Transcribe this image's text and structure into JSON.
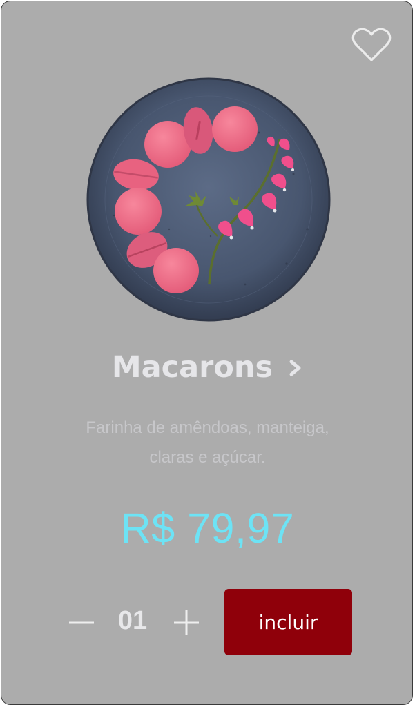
{
  "product": {
    "name": "Macarons",
    "description_line1": "Farinha de amêndoas, manteiga,",
    "description_line2": "claras e açúcar.",
    "price": "R$ 79,97",
    "image": "macarons-plate-image"
  },
  "quantity": {
    "value": "01",
    "decrement_icon": "minus-icon",
    "increment_icon": "plus-icon"
  },
  "actions": {
    "add_label": "incluir",
    "favorite_icon": "heart-outline-icon",
    "details_icon": "chevron-right-icon"
  },
  "colors": {
    "card_background": "#acacac",
    "price": "#6de3f5",
    "button": "#8f000a",
    "title": "#e6e6e9",
    "macaron": "#ee6b85",
    "plate": "#4b5a74"
  }
}
